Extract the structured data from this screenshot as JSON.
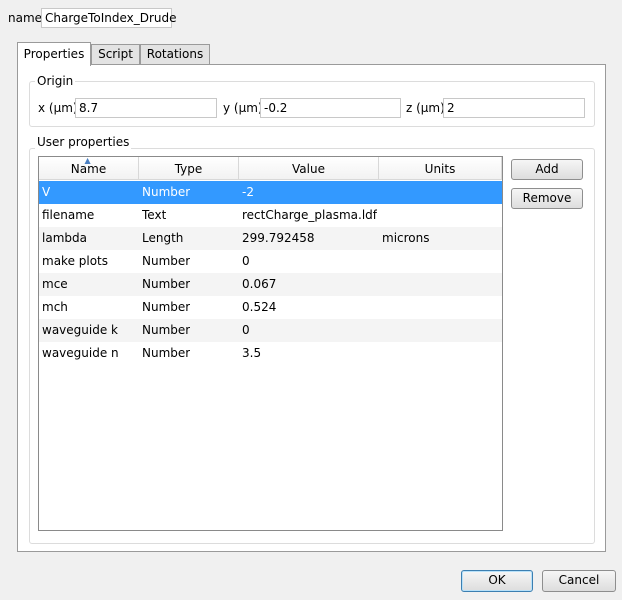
{
  "name": {
    "label": "name",
    "value": "ChargeToIndex_Drude"
  },
  "tabs": [
    {
      "label": "Properties"
    },
    {
      "label": "Script"
    },
    {
      "label": "Rotations"
    }
  ],
  "origin": {
    "title": "Origin",
    "x": {
      "label": "x (µm)",
      "value": "8.7"
    },
    "y": {
      "label": "y (µm)",
      "value": "-0.2"
    },
    "z": {
      "label": "z (µm)",
      "value": "2"
    }
  },
  "user_properties": {
    "title": "User properties",
    "columns": [
      "Name",
      "Type",
      "Value",
      "Units"
    ],
    "rows": [
      {
        "name": "V",
        "type": "Number",
        "value": "-2",
        "units": ""
      },
      {
        "name": "filename",
        "type": "Text",
        "value": "rectCharge_plasma.ldf",
        "units": ""
      },
      {
        "name": "lambda",
        "type": "Length",
        "value": "299.792458",
        "units": "microns"
      },
      {
        "name": "make plots",
        "type": "Number",
        "value": "0",
        "units": ""
      },
      {
        "name": "mce",
        "type": "Number",
        "value": "0.067",
        "units": ""
      },
      {
        "name": "mch",
        "type": "Number",
        "value": "0.524",
        "units": ""
      },
      {
        "name": "waveguide k",
        "type": "Number",
        "value": "0",
        "units": ""
      },
      {
        "name": "waveguide n",
        "type": "Number",
        "value": "3.5",
        "units": ""
      }
    ],
    "add_label": "Add",
    "remove_label": "Remove"
  },
  "footer": {
    "ok_label": "OK",
    "cancel_label": "Cancel"
  }
}
